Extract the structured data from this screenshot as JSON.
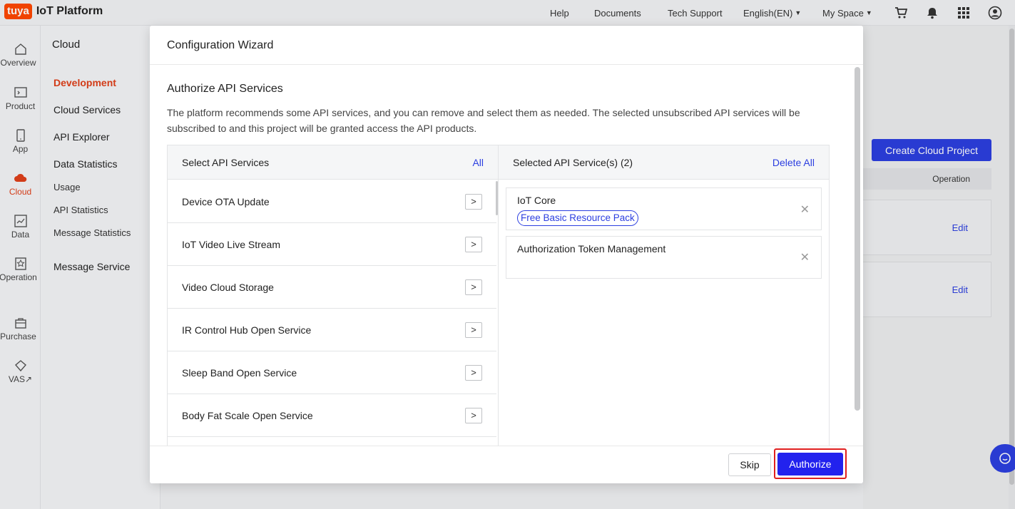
{
  "app": {
    "logo_text": "tuya",
    "title": "IoT Platform"
  },
  "topnav": {
    "help": "Help",
    "documents": "Documents",
    "tech_support": "Tech Support",
    "language": "English(EN)",
    "my_space": "My Space"
  },
  "rail": {
    "items": [
      {
        "label": "Overview",
        "icon": "home-icon"
      },
      {
        "label": "Product",
        "icon": "product-icon"
      },
      {
        "label": "App",
        "icon": "phone-icon"
      },
      {
        "label": "Cloud",
        "icon": "cloud-icon"
      },
      {
        "label": "Data",
        "icon": "chart-icon"
      },
      {
        "label": "Operation",
        "icon": "operation-icon"
      },
      {
        "label": "Purchase",
        "icon": "bag-icon"
      },
      {
        "label": "VAS↗",
        "icon": "diamond-icon"
      }
    ]
  },
  "sidebar": {
    "title": "Cloud",
    "items": [
      {
        "label": "Development"
      },
      {
        "label": "Cloud Services"
      },
      {
        "label": "API Explorer"
      },
      {
        "label": "Data Statistics"
      },
      {
        "label": "Usage"
      },
      {
        "label": "API Statistics"
      },
      {
        "label": "Message Statistics"
      },
      {
        "label": "Message Service"
      }
    ]
  },
  "background": {
    "create_button": "Create Cloud Project",
    "operation_header": "Operation",
    "edit_label": "Edit"
  },
  "modal": {
    "title": "Configuration Wizard",
    "section_title": "Authorize API Services",
    "description": "The platform recommends some API services, and you can remove and select them as needed. The selected unsubscribed API services will be subscribed to and this project will be granted access the API products.",
    "left_pane": {
      "header": "Select API Services",
      "all_link": "All",
      "services": [
        "Device OTA Update",
        "IoT Video Live Stream",
        "Video Cloud Storage",
        "IR Control Hub Open Service",
        "Sleep Band Open Service",
        "Body Fat Scale Open Service"
      ]
    },
    "right_pane": {
      "header": "Selected API Service(s) (2)",
      "delete_all": "Delete All",
      "selected": [
        {
          "name": "IoT Core",
          "tag": "Free Basic Resource Pack"
        },
        {
          "name": "Authorization Token Management"
        }
      ]
    },
    "footer": {
      "skip": "Skip",
      "authorize": "Authorize"
    }
  },
  "colors": {
    "primary": "#2c3fe0",
    "brand": "#ff4800",
    "active": "#e0401a",
    "highlight": "#e02020"
  }
}
